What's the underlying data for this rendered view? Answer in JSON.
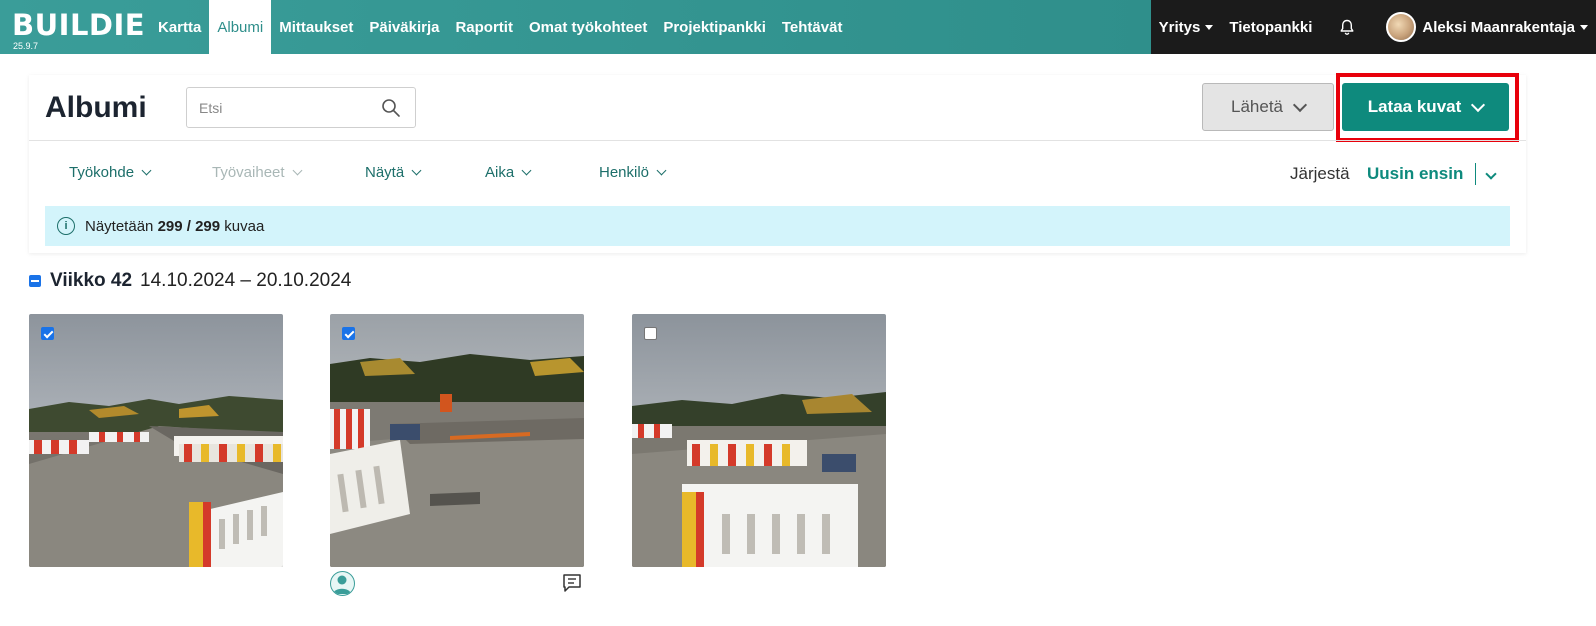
{
  "app": {
    "logo": "BUILDIE",
    "version": "25.9.7"
  },
  "nav": {
    "items": [
      {
        "label": "Kartta",
        "active": false
      },
      {
        "label": "Albumi",
        "active": true
      },
      {
        "label": "Mittaukset",
        "active": false
      },
      {
        "label": "Päiväkirja",
        "active": false
      },
      {
        "label": "Raportit",
        "active": false
      },
      {
        "label": "Omat työkohteet",
        "active": false
      },
      {
        "label": "Projektipankki",
        "active": false
      },
      {
        "label": "Tehtävät",
        "active": false
      }
    ],
    "company": "Yritys",
    "knowledge": "Tietopankki",
    "user": "Aleksi Maanrakentaja"
  },
  "page": {
    "title": "Albumi",
    "search_placeholder": "Etsi",
    "send_label": "Lähetä",
    "upload_label": "Lataa kuvat"
  },
  "filters": [
    {
      "label": "Työkohde",
      "disabled": false
    },
    {
      "label": "Työvaiheet",
      "disabled": true
    },
    {
      "label": "Näytä",
      "disabled": false
    },
    {
      "label": "Aika",
      "disabled": false
    },
    {
      "label": "Henkilö",
      "disabled": false
    }
  ],
  "sort": {
    "label": "Järjestä",
    "value": "Uusin ensin"
  },
  "info": {
    "prefix": "Näytetään",
    "count": "299 / 299",
    "suffix": "kuvaa"
  },
  "week": {
    "name": "Viikko 42",
    "range": "14.10.2024 – 20.10.2024"
  },
  "photos": [
    {
      "checked": true
    },
    {
      "checked": true
    },
    {
      "checked": false
    }
  ],
  "colors": {
    "nav_teal": "#3a9d99",
    "nav_dark": "#1b1b1b",
    "primary": "#0e8a7d",
    "highlight_red": "#e8000b",
    "info_bg": "#d3f4fb",
    "checkbox_blue": "#1a73e8"
  }
}
